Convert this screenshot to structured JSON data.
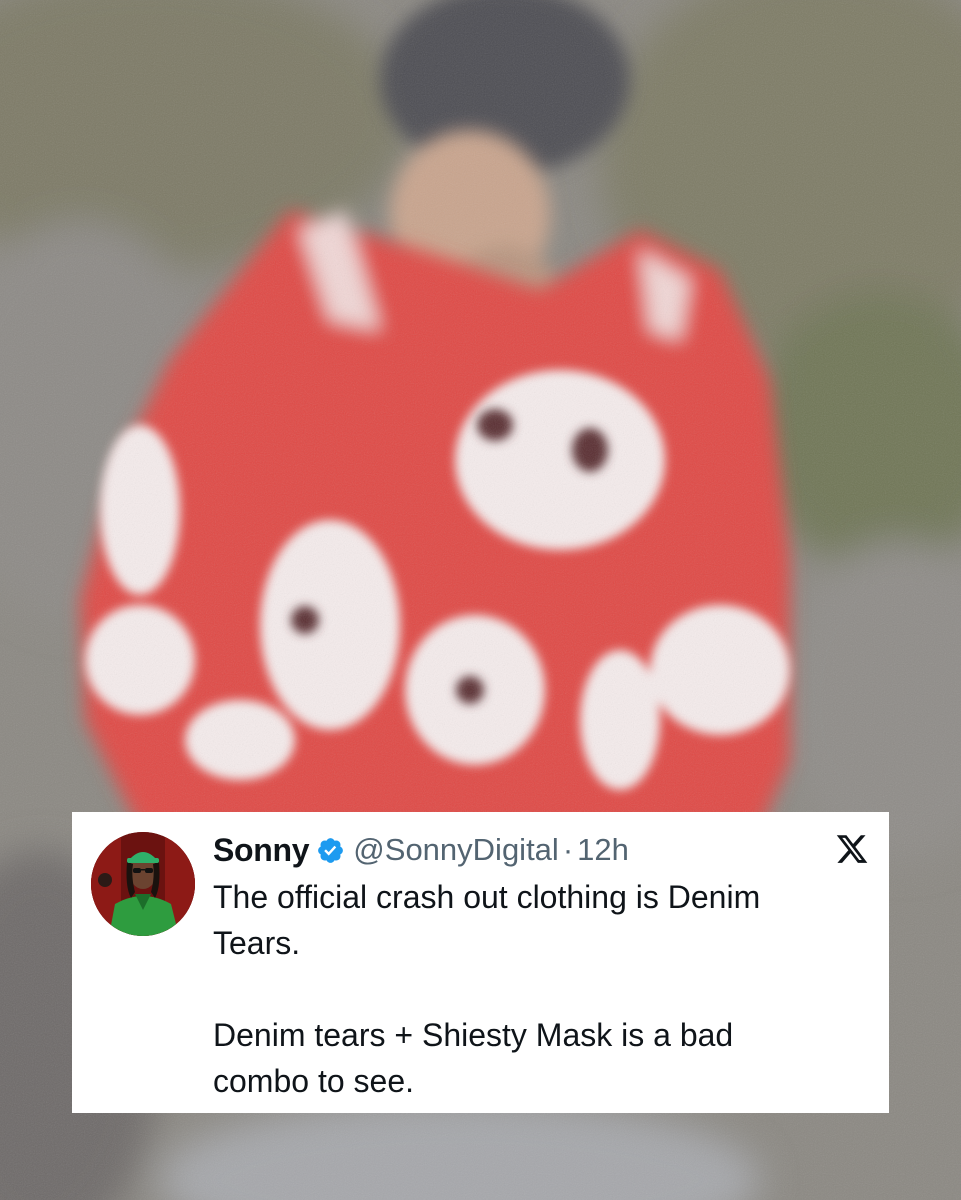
{
  "tweet": {
    "display_name": "Sonny",
    "verified_icon": "verified-badge-icon",
    "handle": "@SonnyDigital",
    "separator": "·",
    "time": "12h",
    "platform_icon": "x-logo-icon",
    "text_paragraph_1_line_1": "The official crash out clothing is Denim",
    "text_paragraph_1_line_2": "Tears.",
    "text_paragraph_2_line_1": "Denim tears + Shiesty Mask is a bad",
    "text_paragraph_2_line_2": "combo to see."
  },
  "colors": {
    "verified_blue": "#1d9bf0",
    "name_text": "#0f1419",
    "meta_text": "#536471",
    "card_background": "#ffffff",
    "sweater_red": "#e54844"
  }
}
